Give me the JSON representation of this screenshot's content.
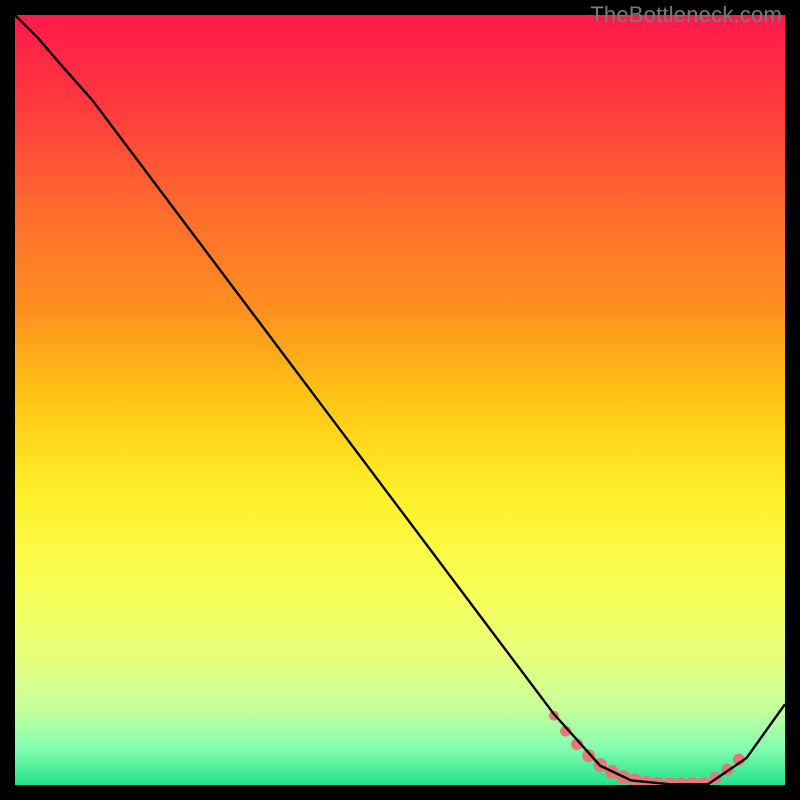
{
  "watermark": "TheBottleneck.com",
  "chart_data": {
    "type": "line",
    "title": "",
    "xlabel": "",
    "ylabel": "",
    "xlim": [
      0,
      100
    ],
    "ylim": [
      0,
      100
    ],
    "grid": false,
    "gradient": {
      "stops": [
        {
          "offset": 0.0,
          "color": "#ff1a4b"
        },
        {
          "offset": 0.12,
          "color": "#ff3a3f"
        },
        {
          "offset": 0.25,
          "color": "#ff6a2e"
        },
        {
          "offset": 0.38,
          "color": "#ff8f1f"
        },
        {
          "offset": 0.5,
          "color": "#ffc515"
        },
        {
          "offset": 0.62,
          "color": "#fff029"
        },
        {
          "offset": 0.75,
          "color": "#f8ff58"
        },
        {
          "offset": 0.83,
          "color": "#e8ff7a"
        },
        {
          "offset": 0.9,
          "color": "#c7ff9a"
        },
        {
          "offset": 0.95,
          "color": "#88ffb0"
        },
        {
          "offset": 1.0,
          "color": "#21e28a"
        }
      ]
    },
    "series": [
      {
        "name": "curve",
        "stroke": "#000000",
        "x": [
          0,
          3,
          6,
          10,
          20,
          30,
          40,
          50,
          60,
          70,
          76,
          80,
          85,
          90,
          95,
          100
        ],
        "y": [
          100,
          97,
          93.5,
          89,
          75.7,
          62.4,
          49.1,
          35.8,
          22.5,
          9.2,
          2.5,
          0.6,
          0.1,
          0.1,
          3.5,
          10.5
        ]
      }
    ],
    "marker_band": {
      "name": "optimal-range",
      "color": "#e47a78",
      "x": [
        70.0,
        71.5,
        73.0,
        74.5,
        76.0,
        77.5,
        79.0,
        80.5,
        82.0,
        83.5,
        85.0,
        86.5,
        88.0,
        89.5,
        91.0,
        92.5,
        94.0
      ],
      "y": [
        9.0,
        7.0,
        5.3,
        3.8,
        2.6,
        1.7,
        1.0,
        0.6,
        0.3,
        0.15,
        0.1,
        0.1,
        0.1,
        0.2,
        0.9,
        2.0,
        3.3
      ],
      "r": [
        5.0,
        5.5,
        6.0,
        6.5,
        7.0,
        7.0,
        7.0,
        7.0,
        7.0,
        7.0,
        7.0,
        7.0,
        7.0,
        6.5,
        6.0,
        6.0,
        6.0
      ]
    }
  }
}
